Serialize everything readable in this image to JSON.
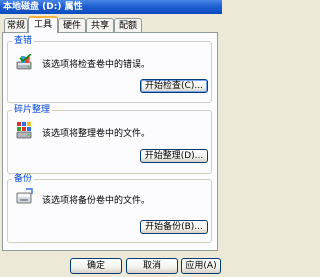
{
  "window": {
    "title": "本地磁盘 (D:) 属性"
  },
  "tabs": [
    {
      "label": "常规",
      "active": false
    },
    {
      "label": "工具",
      "active": true
    },
    {
      "label": "硬件",
      "active": false
    },
    {
      "label": "共享",
      "active": false
    },
    {
      "label": "配额",
      "active": false
    }
  ],
  "groups": {
    "error_check": {
      "title": "查错",
      "description": "该选项将检查卷中的错误。",
      "button": "开始检查(C)...",
      "icon": "disk-check-icon"
    },
    "defrag": {
      "title": "碎片整理",
      "description": "该选项将整理卷中的文件。",
      "button": "开始整理(D)...",
      "icon": "defrag-icon"
    },
    "backup": {
      "title": "备份",
      "description": "该选项将备份卷中的文件。",
      "button": "开始备份(B)...",
      "icon": "backup-icon"
    }
  },
  "footer": {
    "ok": "确定",
    "cancel": "取消",
    "apply": "应用(A)"
  },
  "colors": {
    "accent": "#0046d5",
    "titlebar": "#0c4bbf",
    "tab_highlight": "#f7b33c"
  }
}
